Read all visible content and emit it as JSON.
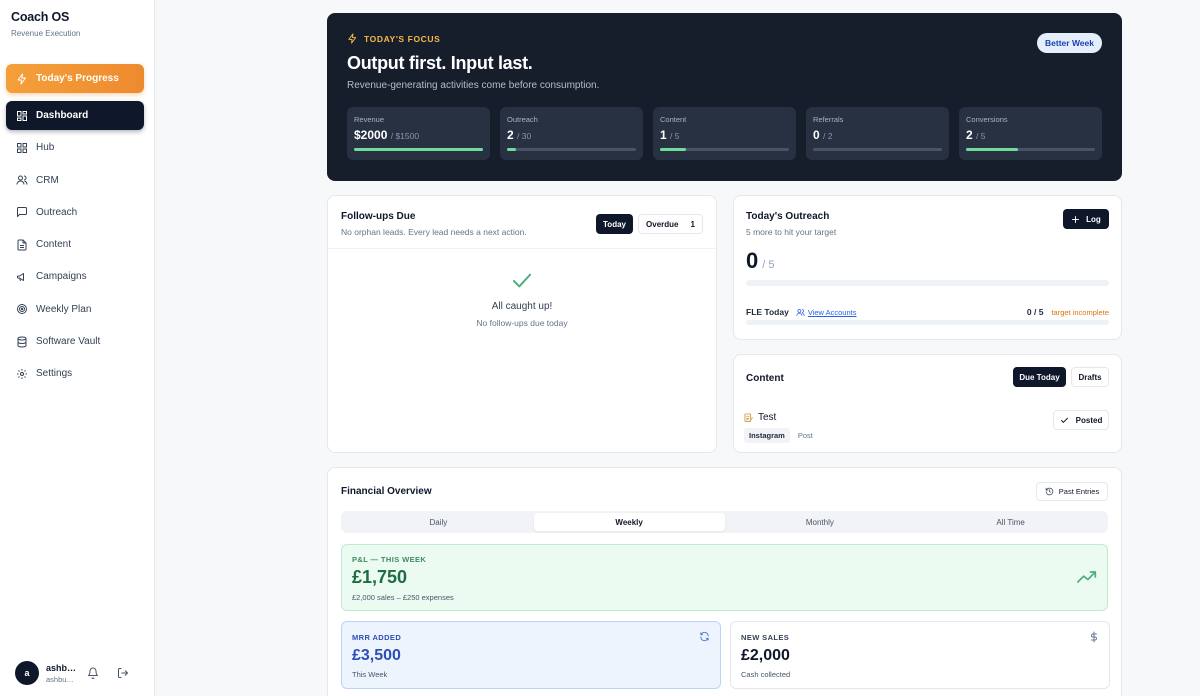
{
  "sidebar": {
    "brand": {
      "title": "Coach OS",
      "subtitle": "Revenue Execution"
    },
    "progress_label": "Today's Progress",
    "items": [
      {
        "label": "Dashboard",
        "icon": "grid-icon",
        "active": true
      },
      {
        "label": "Hub",
        "icon": "grid-icon"
      },
      {
        "label": "CRM",
        "icon": "users-icon"
      },
      {
        "label": "Outreach",
        "icon": "message-icon"
      },
      {
        "label": "Content",
        "icon": "document-icon"
      },
      {
        "label": "Campaigns",
        "icon": "megaphone-icon"
      },
      {
        "label": "Weekly Plan",
        "icon": "target-icon"
      },
      {
        "label": "Software Vault",
        "icon": "database-icon"
      },
      {
        "label": "Settings",
        "icon": "gear-icon"
      }
    ],
    "user": {
      "initial": "a",
      "name": "ashb…",
      "email": "ashbu…"
    }
  },
  "hero": {
    "tag": "TODAY'S FOCUS",
    "title": "Output first. Input last.",
    "subtitle": "Revenue-generating activities come before consumption.",
    "badge": "Better Week",
    "stats": [
      {
        "label": "Revenue",
        "value": "$2000",
        "target": "/ $1500",
        "progress": 1.0
      },
      {
        "label": "Outreach",
        "value": "2",
        "target": "/ 30",
        "progress": 0.07
      },
      {
        "label": "Content",
        "value": "1",
        "target": "/ 5",
        "progress": 0.2
      },
      {
        "label": "Referrals",
        "value": "0",
        "target": "/ 2",
        "progress": 0
      },
      {
        "label": "Conversions",
        "value": "2",
        "target": "/ 5",
        "progress": 0.4
      }
    ]
  },
  "followups": {
    "title": "Follow-ups Due",
    "subtitle": "No orphan leads. Every lead needs a next action.",
    "tab_today": "Today",
    "tab_overdue": "Overdue",
    "overdue_count": "1",
    "empty_title": "All caught up!",
    "empty_sub": "No follow-ups due today"
  },
  "outreach": {
    "title": "Today's Outreach",
    "subtitle": "5 more to hit your target",
    "log_label": "Log",
    "count": "0",
    "target": "/ 5",
    "fle_label": "FLE Today",
    "view_accounts": "View Accounts",
    "fle_count": "0 / 5",
    "fle_status": "target incomplete"
  },
  "content": {
    "title": "Content",
    "tab_due": "Due Today",
    "tab_drafts": "Drafts",
    "item_name": "Test",
    "item_platform": "Instagram",
    "item_type": "Post",
    "posted_label": "Posted"
  },
  "financial": {
    "title": "Financial Overview",
    "past_entries": "Past Entries",
    "segments": [
      "Daily",
      "Weekly",
      "Monthly",
      "All Time"
    ],
    "pl": {
      "tag": "P&L — THIS WEEK",
      "value": "£1,750",
      "sub": "£2,000 sales – £250 expenses"
    },
    "mrr": {
      "tag": "MRR ADDED",
      "value": "£3,500",
      "sub": "This Week"
    },
    "sales": {
      "tag": "NEW SALES",
      "value": "£2,000",
      "sub": "Cash collected"
    }
  },
  "colors": {
    "accent_orange": "#ee8a2e",
    "dark": "#0f172a",
    "success_green": "#6fdc9b",
    "mrr_blue": "#2c4fb5"
  }
}
